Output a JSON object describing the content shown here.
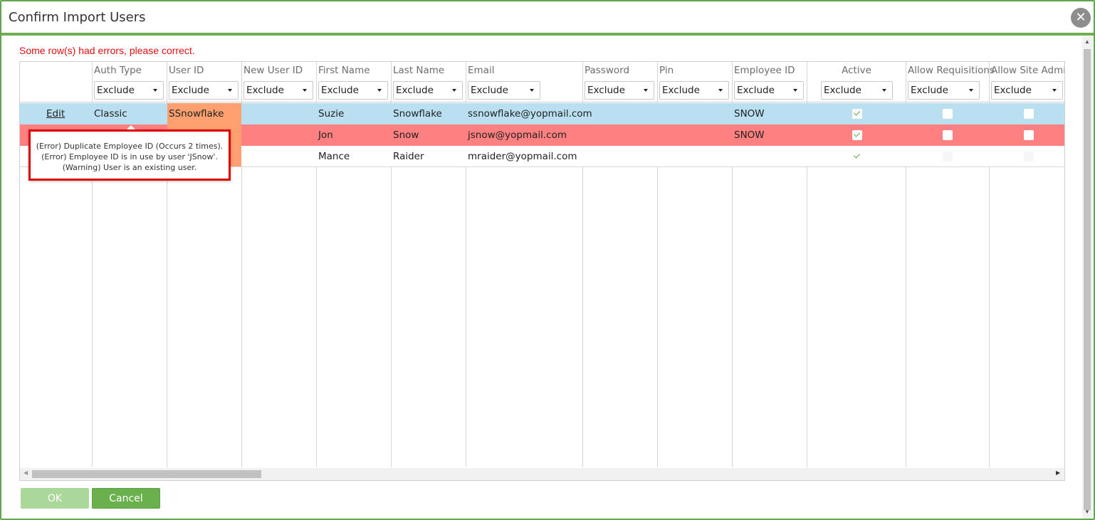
{
  "dialog": {
    "title": "Confirm Import Users",
    "close_glyph": "✕"
  },
  "error_message": "Some row(s) had errors, please correct.",
  "columns": [
    {
      "label": "",
      "filter": ""
    },
    {
      "label": "Auth Type",
      "filter": "Exclude"
    },
    {
      "label": "User ID",
      "filter": "Exclude"
    },
    {
      "label": "New User ID",
      "filter": "Exclude"
    },
    {
      "label": "First Name",
      "filter": "Exclude"
    },
    {
      "label": "Last Name",
      "filter": "Exclude"
    },
    {
      "label": "Email",
      "filter": "Exclude"
    },
    {
      "label": "Password",
      "filter": "Exclude"
    },
    {
      "label": "Pin",
      "filter": "Exclude"
    },
    {
      "label": "Employee ID",
      "filter": "Exclude"
    },
    {
      "label": "Active",
      "filter": "Exclude"
    },
    {
      "label": "Allow Requisitions",
      "filter": "Exclude"
    },
    {
      "label": "Allow Site Admin",
      "filter": "Exclude"
    }
  ],
  "rows": [
    {
      "action": "Edit",
      "auth_type": "Classic",
      "user_id": "SSnowflake",
      "new_user_id": "",
      "first_name": "Suzie",
      "last_name": "Snowflake",
      "email": "ssnowflake@yopmail.com",
      "password": "",
      "pin": "",
      "employee_id": "SNOW",
      "active": true,
      "allow_requisitions": false,
      "allow_site_admin": false,
      "status": "selected"
    },
    {
      "action": "",
      "auth_type": "",
      "user_id": "",
      "new_user_id": "",
      "first_name": "Jon",
      "last_name": "Snow",
      "email": "jsnow@yopmail.com",
      "password": "",
      "pin": "",
      "employee_id": "SNOW",
      "active": true,
      "allow_requisitions": false,
      "allow_site_admin": false,
      "status": "error"
    },
    {
      "action": "",
      "auth_type": "",
      "user_id": "",
      "new_user_id": "",
      "first_name": "Mance",
      "last_name": "Raider",
      "email": "mraider@yopmail.com",
      "password": "",
      "pin": "",
      "employee_id": "",
      "active": true,
      "allow_requisitions": false,
      "allow_site_admin": false,
      "status": "normal"
    }
  ],
  "tooltip": {
    "lines": [
      "(Error) Duplicate Employee ID (Occurs 2 times).",
      "(Error) Employee ID is in use by user 'JSnow'.",
      "(Warning) User is an existing user."
    ]
  },
  "buttons": {
    "ok": "OK",
    "cancel": "Cancel"
  },
  "colors": {
    "accent": "#6ab04c",
    "error_text": "#e01010",
    "selected_row": "#b9dff1",
    "error_row": "#ff8080",
    "warning_cell": "#ffa070"
  }
}
